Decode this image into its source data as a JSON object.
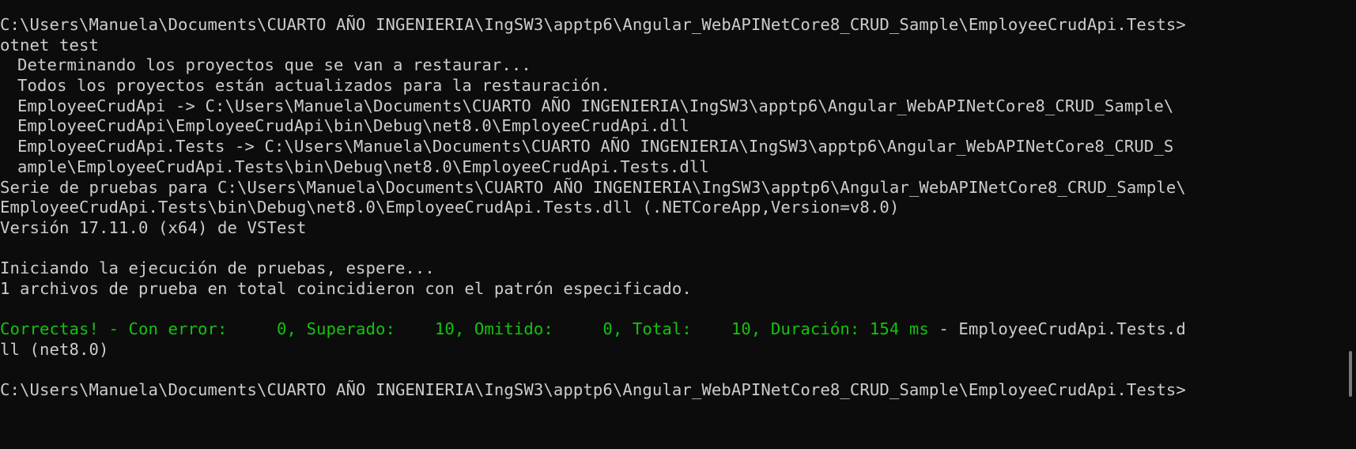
{
  "terminal": {
    "prompt_top": "C:\\Users\\Manuela\\Documents\\CUARTO AÑO INGENIERIA\\IngSW3\\apptp6\\Angular_WebAPINetCore8_CRUD_Sample\\EmployeeCrudApi.Tests>",
    "command": "otnet test",
    "restore_determining": "Determinando los proyectos que se van a restaurar...",
    "restore_uptodate": "Todos los proyectos están actualizados para la restauración.",
    "build_api_1": "EmployeeCrudApi -> C:\\Users\\Manuela\\Documents\\CUARTO AÑO INGENIERIA\\IngSW3\\apptp6\\Angular_WebAPINetCore8_CRUD_Sample\\",
    "build_api_2": "EmployeeCrudApi\\EmployeeCrudApi\\bin\\Debug\\net8.0\\EmployeeCrudApi.dll",
    "build_tests_1": "EmployeeCrudApi.Tests -> C:\\Users\\Manuela\\Documents\\CUARTO AÑO INGENIERIA\\IngSW3\\apptp6\\Angular_WebAPINetCore8_CRUD_S",
    "build_tests_2": "ample\\EmployeeCrudApi.Tests\\bin\\Debug\\net8.0\\EmployeeCrudApi.Tests.dll",
    "test_run_1": "Serie de pruebas para C:\\Users\\Manuela\\Documents\\CUARTO AÑO INGENIERIA\\IngSW3\\apptp6\\Angular_WebAPINetCore8_CRUD_Sample\\",
    "test_run_2": "EmployeeCrudApi.Tests\\bin\\Debug\\net8.0\\EmployeeCrudApi.Tests.dll (.NETCoreApp,Version=v8.0)",
    "vstest_version": "Versión 17.11.0 (x64) de VSTest",
    "starting": "Iniciando la ejecución de pruebas, espere...",
    "files_matched": "1 archivos de prueba en total coincidieron con el patrón especificado.",
    "result_summary": "Correctas! - Con error:     0, Superado:    10, Omitido:     0, Total:    10, Duración: 154 ms",
    "result_suffix_1": " - EmployeeCrudApi.Tests.d",
    "result_suffix_2": "ll (net8.0)",
    "prompt_bottom": "C:\\Users\\Manuela\\Documents\\CUARTO AÑO INGENIERIA\\IngSW3\\apptp6\\Angular_WebAPINetCore8_CRUD_Sample\\EmployeeCrudApi.Tests>"
  },
  "colors": {
    "background": "#0c0c0c",
    "text": "#cccccc",
    "success": "#13c30e",
    "scrollbar_thumb": "#7a7a7a"
  }
}
